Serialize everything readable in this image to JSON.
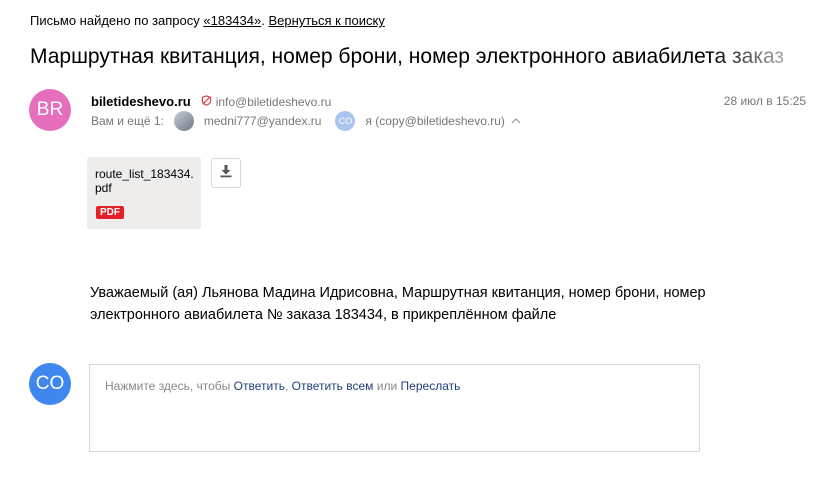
{
  "search_bar": {
    "prefix": "Письмо найдено по запросу",
    "query": "«183434»",
    "separator": ".",
    "back_link": "Вернуться к поиску"
  },
  "subject": "Маршрутная квитанция, номер брони, номер электронного авиабилета заказ",
  "sender": {
    "avatar_initials": "BR",
    "name": "biletideshevo.ru",
    "shield_icon": "shield-icon",
    "email": "info@biletideshevo.ru",
    "date": "28 июл в 15:25"
  },
  "recipients": {
    "label": "Вам и ещё 1:",
    "items": [
      {
        "avatar": "photo",
        "email": "medni777@yandex.ru"
      },
      {
        "avatar": "CO",
        "email": "я (copy@biletideshevo.ru)"
      }
    ],
    "expand_icon": "chevron-up-icon"
  },
  "attachment": {
    "filename": "route_list_183434.pdf",
    "type_badge": "PDF",
    "download_icon": "download-icon"
  },
  "body": {
    "text": "Уважаемый (ая) Льянова Мадина Идрисовна, Маршрутная квитанция, номер брони, номер электронного авиабилета № заказа 183434, в прикреплённом файле"
  },
  "reply": {
    "avatar_initials": "CO",
    "prefix": "Нажмите здесь, чтобы",
    "reply_link": "Ответить",
    "comma": ",",
    "reply_all_link": "Ответить всем",
    "or": "или",
    "forward_link": "Переслать"
  },
  "colors": {
    "sender_avatar": "#e66fbd",
    "user_avatar": "#3f87ee",
    "pdf_badge": "#e3212a",
    "link": "#1f3f78"
  }
}
